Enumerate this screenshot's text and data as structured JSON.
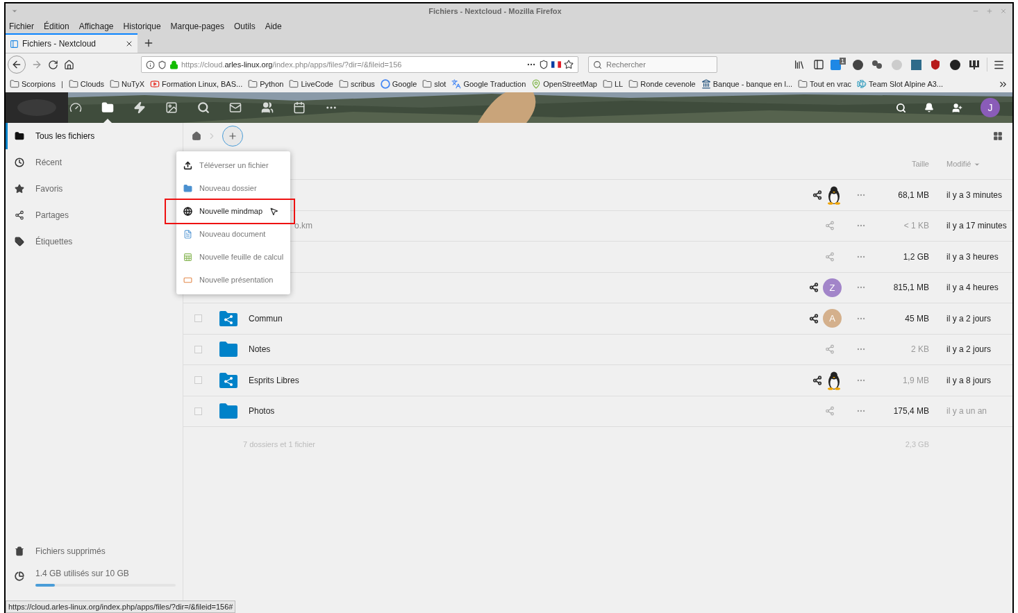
{
  "window": {
    "title": "Fichiers - Nextcloud - Mozilla Firefox"
  },
  "menu": [
    "Fichier",
    "Édition",
    "Affichage",
    "Historique",
    "Marque-pages",
    "Outils",
    "Aide"
  ],
  "tabs": [
    {
      "label": "Fichiers - Nextcloud",
      "selected": true
    }
  ],
  "url": {
    "prefix": "https://cloud.",
    "domain": "arles-linux.org",
    "path": "/index.php/apps/files/?dir=/&fileid=156"
  },
  "search": {
    "placeholder": "Rechercher"
  },
  "extensions": [
    {
      "kind": "sync",
      "badge": "1"
    },
    {
      "kind": "bplus"
    },
    {
      "kind": "dots"
    },
    {
      "kind": "globe"
    },
    {
      "kind": "bank"
    },
    {
      "kind": "shield"
    },
    {
      "kind": "lock"
    },
    {
      "kind": "w"
    }
  ],
  "bookmarks": [
    {
      "kind": "folder",
      "label": "Scorpions"
    },
    {
      "kind": "separator",
      "label": "|"
    },
    {
      "kind": "folder",
      "label": "Clouds"
    },
    {
      "kind": "folder",
      "label": "NuTyX"
    },
    {
      "kind": "video",
      "label": "Formation Linux, BAS..."
    },
    {
      "kind": "folder",
      "label": "Python"
    },
    {
      "kind": "folder",
      "label": "LiveCode"
    },
    {
      "kind": "folder",
      "label": "scribus"
    },
    {
      "kind": "google",
      "label": "Google"
    },
    {
      "kind": "folder",
      "label": "slot"
    },
    {
      "kind": "translate",
      "label": "Google Traduction"
    },
    {
      "kind": "map",
      "label": "OpenStreetMap"
    },
    {
      "kind": "folder",
      "label": "LL"
    },
    {
      "kind": "folder",
      "label": "Ronde cevenole"
    },
    {
      "kind": "bank",
      "label": "Banque - banque en l..."
    },
    {
      "kind": "folder",
      "label": "Tout en vrac"
    },
    {
      "kind": "slot",
      "label": "Team Slot Alpine A3..."
    }
  ],
  "apps": [
    {
      "kind": "dashboard",
      "selected": false
    },
    {
      "kind": "files",
      "selected": true
    },
    {
      "kind": "activity",
      "selected": false
    },
    {
      "kind": "gallery",
      "selected": false
    },
    {
      "kind": "talk",
      "selected": false
    },
    {
      "kind": "mail",
      "selected": false
    },
    {
      "kind": "contacts",
      "selected": false
    },
    {
      "kind": "calendar",
      "selected": false
    },
    {
      "kind": "more",
      "selected": false
    }
  ],
  "user": {
    "initial": "J"
  },
  "sidebar": {
    "items": [
      {
        "kind": "folder",
        "label": "Tous les fichiers",
        "selected": true
      },
      {
        "kind": "clock",
        "label": "Récent",
        "selected": false
      },
      {
        "kind": "star",
        "label": "Favoris",
        "selected": false
      },
      {
        "kind": "share",
        "label": "Partages",
        "selected": false
      },
      {
        "kind": "tag",
        "label": "Étiquettes",
        "selected": false
      }
    ],
    "trash": "Fichiers supprimés",
    "quota": {
      "label": "1.4 GB utilisés sur 10 GB",
      "level": 0.14
    }
  },
  "new_menu": {
    "items": [
      {
        "kind": "upload",
        "label": "Téléverser un fichier",
        "highlighted": false
      },
      {
        "kind": "folder",
        "label": "Nouveau dossier",
        "highlighted": false
      },
      {
        "kind": "mindmap",
        "label": "Nouvelle mindmap",
        "highlighted": true
      },
      {
        "kind": "document",
        "label": "Nouveau document",
        "highlighted": false
      },
      {
        "kind": "sheet",
        "label": "Nouvelle feuille de calcul",
        "highlighted": false
      },
      {
        "kind": "slides",
        "label": "Nouvelle présentation",
        "highlighted": false
      }
    ]
  },
  "table": {
    "columns": [
      "Taille",
      "Modifié"
    ],
    "rows": [
      {
        "shared": true,
        "avatar": {
          "kind": "penguin"
        },
        "size": "68,1 MB",
        "size_dim": false,
        "modified": "il y a 3 minutes",
        "modified_dim": false
      },
      {
        "name": "o.km",
        "shared": false,
        "size": "< 1 KB",
        "size_dim": true,
        "modified": "il y a 17 minutes",
        "modified_dim": false
      },
      {
        "shared": false,
        "size": "1,2 GB",
        "size_dim": false,
        "modified": "il y a 3 heures",
        "modified_dim": false
      },
      {
        "shared": true,
        "avatar": {
          "kind": "letter",
          "initial": "Z",
          "color": "#a285c9"
        },
        "size": "815,1 MB",
        "size_dim": false,
        "modified": "il y a 4 heures",
        "modified_dim": false
      },
      {
        "checked": false,
        "kind": "shared-folder",
        "name": "Commun",
        "shared": true,
        "avatar": {
          "kind": "letter",
          "initial": "A",
          "color": "#d4b08c"
        },
        "size": "45 MB",
        "size_dim": false,
        "modified": "il y a 2 jours",
        "modified_dim": false
      },
      {
        "checked": false,
        "kind": "folder",
        "name": "Notes",
        "shared": false,
        "size": "2 KB",
        "size_dim": true,
        "modified": "il y a 2 jours",
        "modified_dim": false
      },
      {
        "checked": false,
        "kind": "shared-folder",
        "name": "Esprits Libres",
        "shared": true,
        "avatar": {
          "kind": "penguin"
        },
        "size": "1,9 MB",
        "size_dim": true,
        "modified": "il y a 8 jours",
        "modified_dim": false
      },
      {
        "checked": false,
        "kind": "folder",
        "name": "Photos",
        "shared": false,
        "size": "175,4 MB",
        "size_dim": false,
        "modified": "il y a un an",
        "modified_dim": true
      }
    ],
    "summary": {
      "label": "7 dossiers et 1 fichier",
      "size": "2,3 GB"
    }
  },
  "status_bar": "https://cloud.arles-linux.org/index.php/apps/files/?dir=/&fileid=156#"
}
